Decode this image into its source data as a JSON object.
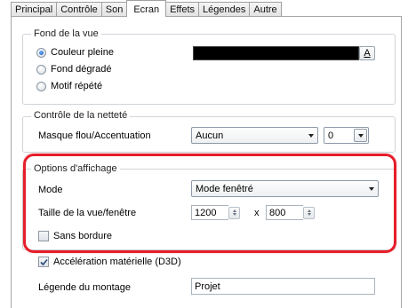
{
  "tabs": [
    "Principal",
    "Contrôle",
    "Son",
    "Ecran",
    "Effets",
    "Légendes",
    "Autre"
  ],
  "active_tab": "Ecran",
  "background_group": {
    "title": "Fond de la vue",
    "options": [
      "Couleur pleine",
      "Fond dégradé",
      "Motif répété"
    ],
    "selected": "Couleur pleine",
    "color_value": "#000000",
    "color_button_label": "A"
  },
  "sharpness_group": {
    "title": "Contrôle de la netteté",
    "mask_label": "Masque flou/Accentuation",
    "mask_value": "Aucun",
    "level_value": "0"
  },
  "display_group": {
    "title": "Options d'affichage",
    "mode_label": "Mode",
    "mode_value": "Mode fenêtré",
    "size_label": "Taille de la vue/fenêtre",
    "width_value": "1200",
    "times": "x",
    "height_value": "800",
    "borderless_label": "Sans bordure",
    "borderless_checked": false
  },
  "hardware_accel": {
    "label": "Accélération matérielle (D3D)",
    "checked": true
  },
  "montage": {
    "label": "Légende du montage",
    "value": "Projet"
  },
  "colors": {
    "highlight": "#e61e2a",
    "accent": "#1a56b8"
  }
}
